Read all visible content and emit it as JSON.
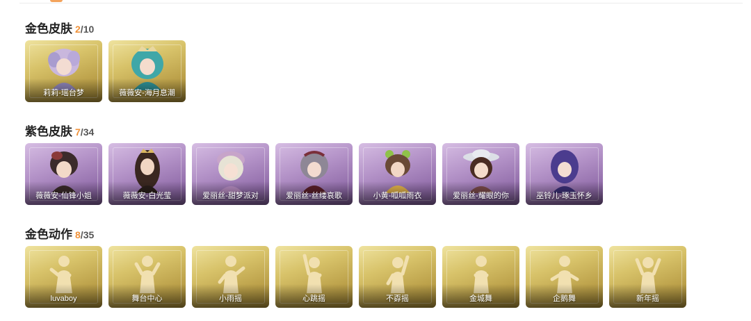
{
  "sections": [
    {
      "title": "金色皮肤",
      "owned": "2",
      "separator": "/",
      "total": "10",
      "items": [
        {
          "label": "莉莉-瑶台梦",
          "icon": "character-portrait-icon"
        },
        {
          "label": "薇薇安-海月息潮",
          "icon": "character-portrait-icon"
        }
      ]
    },
    {
      "title": "紫色皮肤",
      "owned": "7",
      "separator": "/",
      "total": "34",
      "items": [
        {
          "label": "薇薇安-仙锋小姐",
          "icon": "character-portrait-icon"
        },
        {
          "label": "薇薇安-白光莹",
          "icon": "character-portrait-icon"
        },
        {
          "label": "爱丽丝-甜梦派对",
          "icon": "character-portrait-icon"
        },
        {
          "label": "爱丽丝-丝缕哀歌",
          "icon": "character-portrait-icon"
        },
        {
          "label": "小黄-呱呱雨衣",
          "icon": "character-portrait-icon"
        },
        {
          "label": "爱丽丝-耀眼的你",
          "icon": "character-portrait-icon"
        },
        {
          "label": "巫铃儿-琢玉怀乡",
          "icon": "character-portrait-icon"
        }
      ]
    },
    {
      "title": "金色动作",
      "owned": "8",
      "separator": "/",
      "total": "35",
      "items": [
        {
          "label": "luvaboy",
          "icon": "emote-pose-icon"
        },
        {
          "label": "舞台中心",
          "icon": "emote-pose-icon"
        },
        {
          "label": "小雨摇",
          "icon": "emote-pose-icon"
        },
        {
          "label": "心跳摇",
          "icon": "emote-pose-icon"
        },
        {
          "label": "不孬摇",
          "icon": "emote-pose-icon"
        },
        {
          "label": "金城舞",
          "icon": "emote-pose-icon"
        },
        {
          "label": "企鹅舞",
          "icon": "emote-pose-icon"
        },
        {
          "label": "新年摇",
          "icon": "emote-pose-icon"
        }
      ]
    }
  ],
  "colors": {
    "owned_count": "#f0923a",
    "gold_card": "#c9b25a",
    "purple_card": "#9a78b3",
    "top_accent": "#f3a35c"
  }
}
